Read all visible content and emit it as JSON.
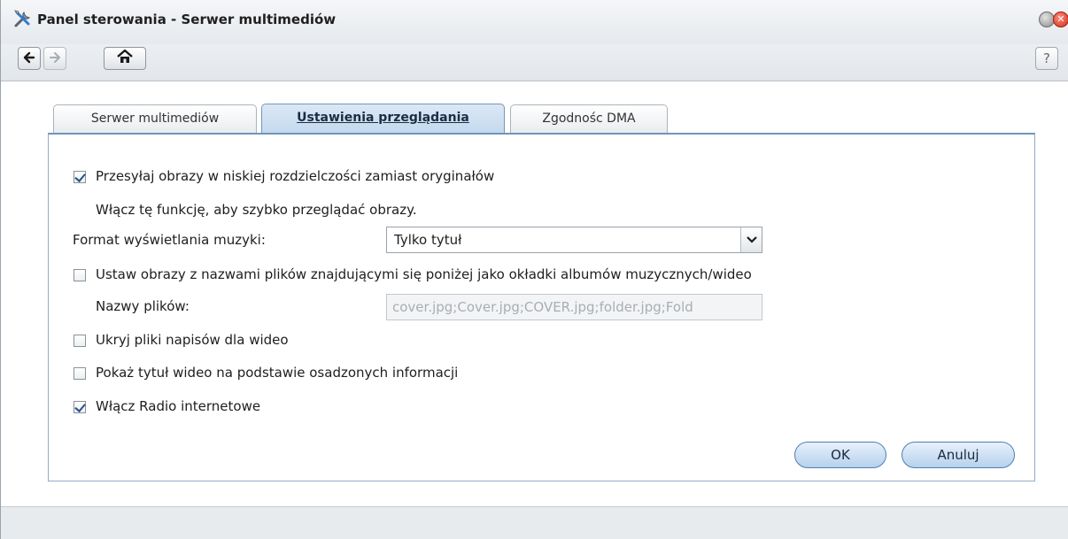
{
  "window": {
    "title": "Panel sterowania - Serwer multimediów",
    "help_label": "?",
    "close_glyph": "✕"
  },
  "toolbar": {
    "back_icon": "arrow-left-icon",
    "forward_icon": "arrow-right-icon",
    "home_icon": "home-icon"
  },
  "tabs": [
    {
      "label": "Serwer multimediów",
      "active": false
    },
    {
      "label": "Ustawienia przeglądania",
      "active": true
    },
    {
      "label": "Zgodnośc DMA",
      "active": false
    }
  ],
  "settings": {
    "low_res": {
      "label": "Przesyłaj obrazy w niskiej rozdzielczości zamiast oryginałów",
      "checked": true,
      "hint": "Włącz tę funkcję, aby szybko przeglądać obrazy."
    },
    "music_format": {
      "label": "Format wyświetlania muzyki:",
      "value": "Tylko tytuł"
    },
    "cover_art": {
      "label": "Ustaw obrazy z nazwami plików znajdującymi się poniżej jako okładki albumów muzycznych/wideo",
      "checked": false
    },
    "file_names": {
      "label": "Nazwy plików:",
      "value": "cover.jpg;Cover.jpg;COVER.jpg;folder.jpg;Fold"
    },
    "hide_subtitles": {
      "label": "Ukryj pliki napisów dla wideo",
      "checked": false
    },
    "embedded_title": {
      "label": "Pokaż tytuł wideo na podstawie osadzonych informacji",
      "checked": false
    },
    "internet_radio": {
      "label": "Włącz Radio internetowe",
      "checked": true
    }
  },
  "buttons": {
    "ok": "OK",
    "cancel": "Anuluj"
  }
}
